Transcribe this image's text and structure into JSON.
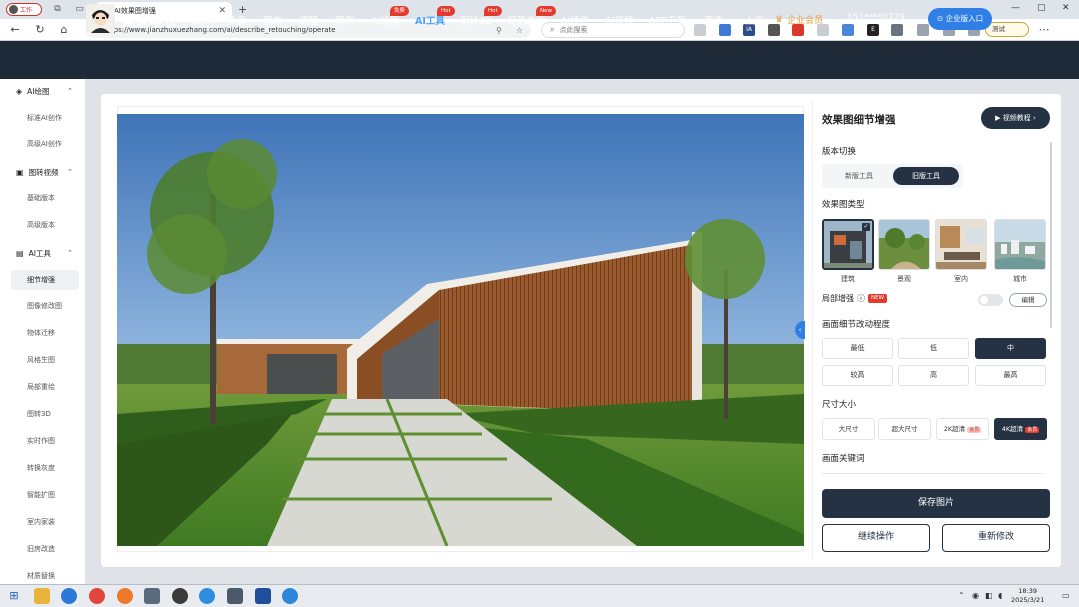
{
  "browser": {
    "profile_label": "工作",
    "tab_title": "AI效果图增强",
    "url": "https://www.jianzhuxuezhang.com/ai/describe_retouching/operate",
    "search_placeholder": "点此搜索",
    "beta_label": "测试"
  },
  "header": {
    "logo_text": "建筑学长",
    "nav": [
      {
        "label": "首页"
      },
      {
        "label": "资源"
      },
      {
        "label": "图库"
      },
      {
        "label": "课程"
      },
      {
        "label": "案例"
      },
      {
        "label": "AI绘图",
        "badge": "免费"
      },
      {
        "label": "AI工具",
        "badge": "Hot"
      },
      {
        "label": "图转3D",
        "badge": "Hot"
      },
      {
        "label": "规范查询",
        "badge": "New"
      },
      {
        "label": "AI插件"
      },
      {
        "label": "AI视频"
      },
      {
        "label": "APP下载"
      },
      {
        "label": "更多"
      },
      {
        "label": "上传"
      }
    ],
    "vip_label": "企业会员",
    "phone": "151****0729",
    "enterprise_btn": "企业版入口"
  },
  "sidebar": {
    "groups": [
      {
        "label": "AI绘图",
        "items": [
          "标准AI创作",
          "高级AI创作"
        ]
      },
      {
        "label": "图转视频",
        "items": [
          "基础版本",
          "高级版本"
        ]
      },
      {
        "label": "AI工具",
        "items": [
          "细节增强",
          "图像修改图",
          "物体迁移",
          "风格生图",
          "局部重绘",
          "图转3D",
          "实时作图",
          "转换灰度",
          "智能扩图",
          "室内家装",
          "旧房改造",
          "材质替换"
        ]
      }
    ],
    "active_item": "细节增强"
  },
  "panel": {
    "title": "效果图细节增强",
    "tutorial_btn": "视频教程",
    "version_label": "版本切换",
    "versions": [
      "新版工具",
      "旧版工具"
    ],
    "active_version": "旧版工具",
    "type_label": "效果图类型",
    "types": [
      "建筑",
      "景观",
      "室内",
      "城市"
    ],
    "active_type": "建筑",
    "local_label": "局部增强",
    "local_new": "NEW",
    "local_btn": "编辑",
    "local_enabled": false,
    "detail_label": "画面细节改动程度",
    "levels": [
      "最低",
      "低",
      "中",
      "较高",
      "高",
      "最高"
    ],
    "active_level": "中",
    "size_label": "尺寸大小",
    "sizes": [
      {
        "label": "大尺寸",
        "tag": ""
      },
      {
        "label": "超大尺寸",
        "tag": ""
      },
      {
        "label": "2K超清",
        "tag": "会员"
      },
      {
        "label": "4K超清",
        "tag": "会员"
      }
    ],
    "active_size": "4K超清",
    "keyword_label": "画面关键词",
    "save_btn": "保存图片",
    "continue_btn": "继续操作",
    "redo_btn": "重新修改"
  },
  "taskbar": {
    "time": "18:39",
    "date": "2025/3/21"
  },
  "colors": {
    "header_bg": "#1f2a38",
    "accent_dark": "#243244",
    "accent_blue": "#2f7fe6",
    "hot_red": "#e23b2e",
    "vip_gold": "#e8a040"
  }
}
